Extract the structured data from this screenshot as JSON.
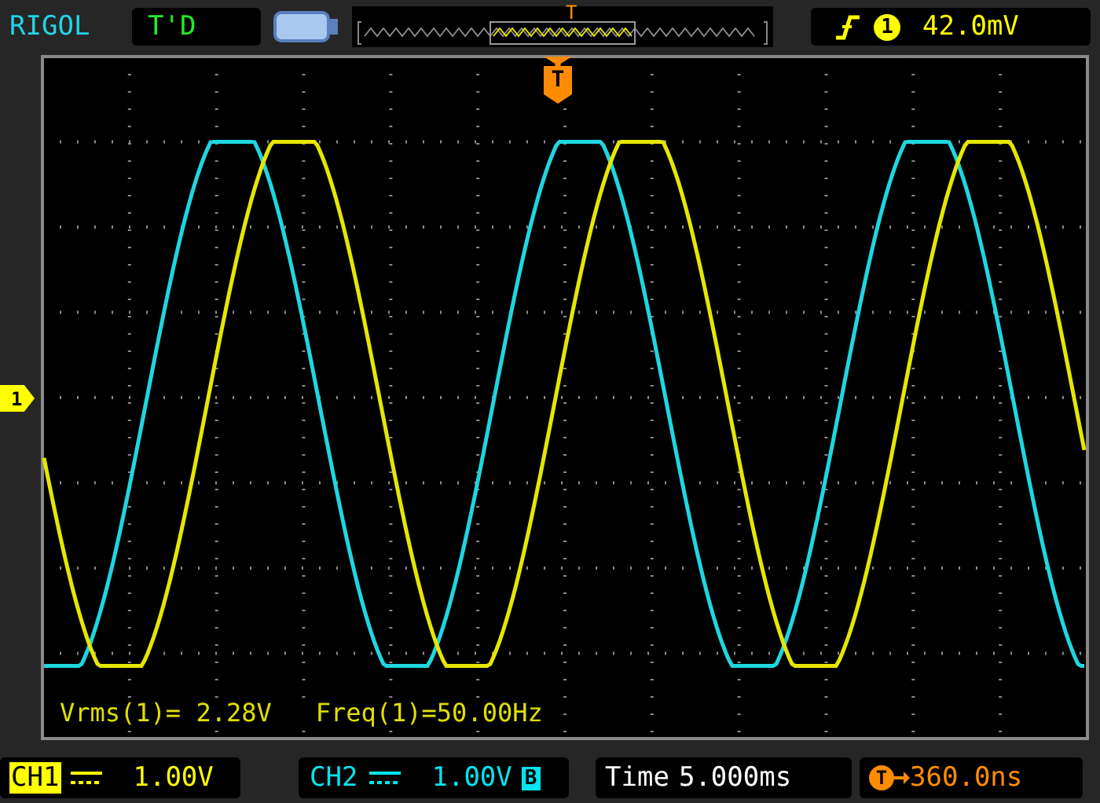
{
  "header": {
    "brand": "RIGOL",
    "run_status": "T'D",
    "trigger_marker": "T",
    "trigger_channel": "1",
    "trigger_level": "42.0mV"
  },
  "screen": {
    "trigger_position_marker": "T",
    "ch1_marker": "1",
    "measurements": [
      "Vrms(1)= 2.28V",
      "Freq(1)=50.00Hz"
    ]
  },
  "footer": [
    {
      "kind": "channel",
      "label": "CH1",
      "scale": "1.00V",
      "color": "#ffff00",
      "highlighted": true
    },
    {
      "kind": "channel",
      "label": "CH2",
      "scale": "1.00V",
      "color": "#00e5ee",
      "highlighted": false,
      "badge": "B"
    },
    {
      "kind": "time",
      "label": "Time",
      "value": "5.000ms"
    },
    {
      "kind": "offset",
      "icon": "T",
      "value": "360.0ns"
    }
  ]
}
